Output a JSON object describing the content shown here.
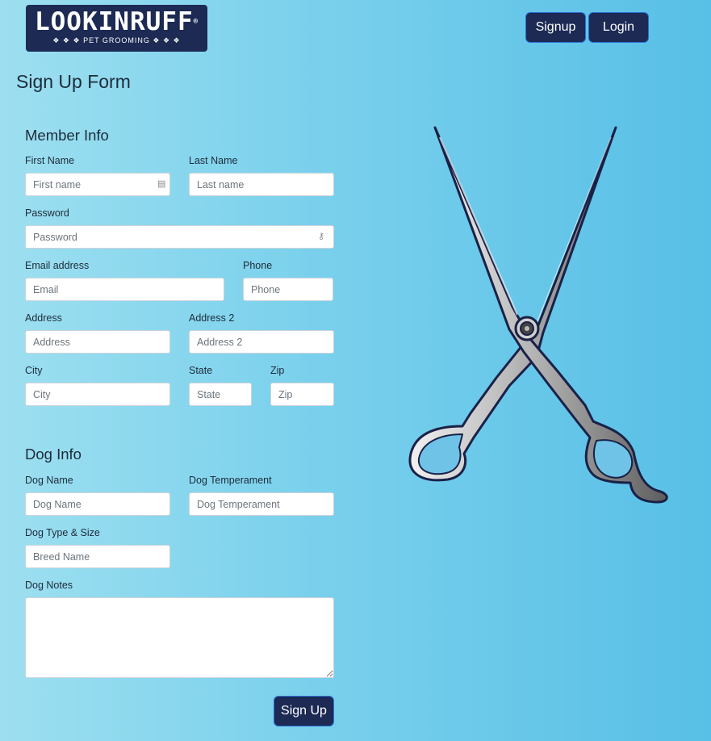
{
  "header": {
    "logo_main": "LOOKINRUFF",
    "logo_sub": "❖ ❖ ❖ PET GROOMING ❖ ❖ ❖",
    "signup_label": "Signup",
    "login_label": "Login"
  },
  "page_title": "Sign Up Form",
  "member": {
    "heading": "Member Info",
    "first_name": {
      "label": "First Name",
      "placeholder": "First name"
    },
    "last_name": {
      "label": "Last Name",
      "placeholder": "Last name"
    },
    "password": {
      "label": "Password",
      "placeholder": "Password"
    },
    "email": {
      "label": "Email address",
      "placeholder": "Email"
    },
    "phone": {
      "label": "Phone",
      "placeholder": "Phone"
    },
    "address": {
      "label": "Address",
      "placeholder": "Address"
    },
    "address2": {
      "label": "Address 2",
      "placeholder": "Address 2"
    },
    "city": {
      "label": "City",
      "placeholder": "City"
    },
    "state": {
      "label": "State",
      "placeholder": "State"
    },
    "zip": {
      "label": "Zip",
      "placeholder": "Zip"
    }
  },
  "dog": {
    "heading": "Dog Info",
    "name": {
      "label": "Dog Name",
      "placeholder": "Dog Name"
    },
    "temperament": {
      "label": "Dog Temperament",
      "placeholder": "Dog Temperament"
    },
    "type": {
      "label": "Dog Type & Size",
      "placeholder": "Breed Name"
    },
    "notes": {
      "label": "Dog Notes",
      "placeholder": ""
    }
  },
  "submit_label": "Sign Up",
  "colors": {
    "brand_navy": "#1c2a54",
    "button_border": "#2b6fd6"
  },
  "icons": {
    "autofill": "contact-card-icon",
    "password": "key-icon",
    "decor": "scissors-icon"
  }
}
